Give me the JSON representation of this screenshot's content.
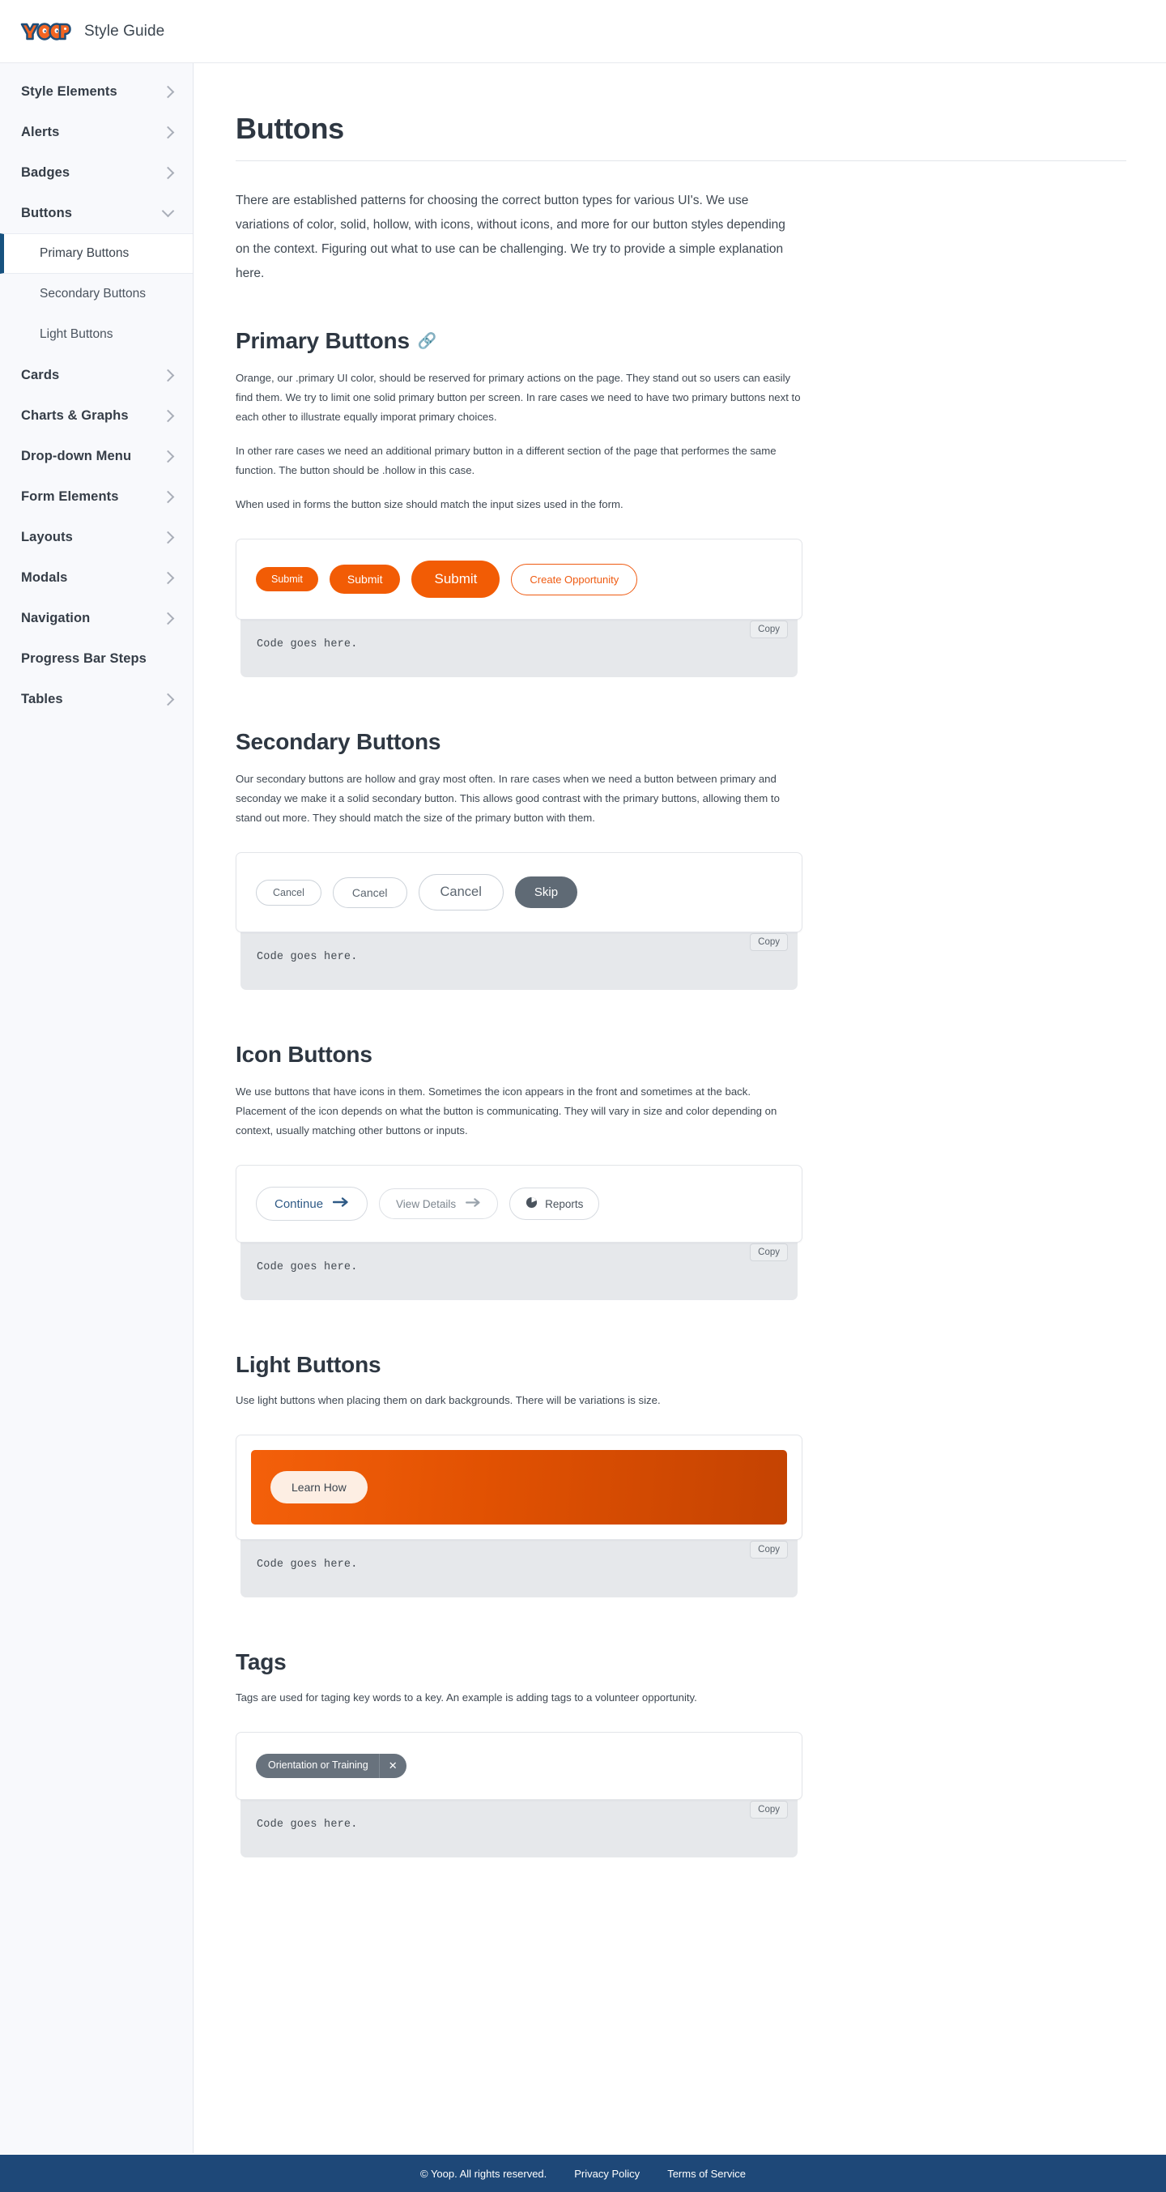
{
  "topbar": {
    "logo_alt": "YOOP",
    "logo_colors": {
      "fill": "#F26522",
      "outline": "#1F4E79"
    },
    "title": "Style Guide"
  },
  "sidebar": {
    "items": [
      {
        "label": "Style Elements",
        "chevron": "chevron-right",
        "expanded": false
      },
      {
        "label": "Alerts",
        "chevron": "chevron-right",
        "expanded": false
      },
      {
        "label": "Badges",
        "chevron": "chevron-right",
        "expanded": false
      },
      {
        "label": "Buttons",
        "chevron": "chevron-down",
        "expanded": true
      },
      {
        "label": "Cards",
        "chevron": "chevron-right",
        "expanded": false
      },
      {
        "label": "Charts & Graphs",
        "chevron": "chevron-right",
        "expanded": false
      },
      {
        "label": "Drop-down Menu",
        "chevron": "chevron-right",
        "expanded": false
      },
      {
        "label": "Form Elements",
        "chevron": "chevron-right",
        "expanded": false
      },
      {
        "label": "Layouts",
        "chevron": "chevron-right",
        "expanded": false
      },
      {
        "label": "Modals",
        "chevron": "chevron-right",
        "expanded": false
      },
      {
        "label": "Navigation",
        "chevron": "chevron-right",
        "expanded": false
      },
      {
        "label": "Progress Bar Steps",
        "chevron": "none",
        "expanded": false
      },
      {
        "label": "Tables",
        "chevron": "chevron-right",
        "expanded": false
      }
    ],
    "buttons_subitems": [
      {
        "label": "Primary Buttons",
        "active": true
      },
      {
        "label": "Secondary Buttons",
        "active": false
      },
      {
        "label": "Light Buttons",
        "active": false
      }
    ],
    "active_accent": "#17527F",
    "background": "#F8F9FC"
  },
  "main": {
    "page_title": "Buttons",
    "intro": "There are established patterns for choosing the correct button types for various UI's. We use variations of color, solid, hollow, with icons, without icons, and more for our button styles depending on the context. Figuring out what to use can be challenging. We try to provide a simple explanation here.",
    "sections": {
      "primary": {
        "heading": "Primary Buttons",
        "anchor_icon": "link-icon",
        "paragraphs": [
          "Orange, our .primary UI color, should be reserved for primary actions on the page. They stand out so users can easily find them. We try to limit one solid primary button per screen. In rare cases we need to have two primary buttons next to each other to illustrate equally imporat primary choices.",
          "In other rare cases we need an additional primary button in a different section of the page that performes the same function. The button should be .hollow in this case.",
          "When used in forms the button size should match the input sizes used in the form."
        ],
        "buttons": [
          {
            "label": "Submit",
            "style": "solid",
            "size": "sm"
          },
          {
            "label": "Submit",
            "style": "solid",
            "size": "md"
          },
          {
            "label": "Submit",
            "style": "solid",
            "size": "lg"
          },
          {
            "label": "Create Opportunity",
            "style": "hollow",
            "size": "md"
          }
        ],
        "code": "Code goes here.",
        "copy_label": "Copy"
      },
      "secondary": {
        "heading": "Secondary Buttons",
        "paragraphs": [
          "Our secondary buttons are hollow and gray most often.  In rare cases when we need a button between primary and seconday we make it a solid secondary button. This allows good contrast with the primary buttons, allowing them to stand out more. They should match the size of the primary button with them."
        ],
        "buttons": [
          {
            "label": "Cancel",
            "style": "hollow",
            "size": "sm"
          },
          {
            "label": "Cancel",
            "style": "hollow",
            "size": "md"
          },
          {
            "label": "Cancel",
            "style": "hollow",
            "size": "lg"
          },
          {
            "label": "Skip",
            "style": "solid",
            "size": "md"
          }
        ],
        "code": "Code goes here.",
        "copy_label": "Copy"
      },
      "icon": {
        "heading": "Icon Buttons",
        "paragraphs": [
          "We use buttons that have icons in them. Sometimes the icon appears in the front and sometimes at the back. Placement of the icon depends on what the button is communicating. They will vary in size and color depending on context, usually matching other buttons or inputs."
        ],
        "buttons": [
          {
            "label": "Continue",
            "icon": "arrow-right-icon",
            "icon_position": "after",
            "tone": "navy"
          },
          {
            "label": "View Details",
            "icon": "arrow-right-icon",
            "icon_position": "after",
            "tone": "gray"
          },
          {
            "label": "Reports",
            "icon": "pie-chart-icon",
            "icon_position": "before",
            "tone": "dark"
          }
        ],
        "code": "Code goes here.",
        "copy_label": "Copy"
      },
      "light": {
        "heading": "Light Buttons",
        "paragraphs": [
          "Use light buttons when placing them on dark backgrounds. There will be variations is size."
        ],
        "buttons": [
          {
            "label": "Learn How",
            "style": "light"
          }
        ],
        "gradient_from": "#F4600A",
        "gradient_to": "#C44302",
        "code": "Code goes here.",
        "copy_label": "Copy"
      },
      "tags": {
        "heading": "Tags",
        "paragraphs": [
          "Tags are used for taging key words to a key. An example is adding tags to a volunteer opportunity."
        ],
        "tag": {
          "label": "Orientation or Training",
          "close_icon": "close-icon"
        },
        "code": "Code goes here.",
        "copy_label": "Copy"
      }
    }
  },
  "footer": {
    "copyright": "© Yoop. All rights reserved.",
    "privacy": "Privacy Policy",
    "terms": "Terms of Service",
    "background": "#1E4878"
  }
}
